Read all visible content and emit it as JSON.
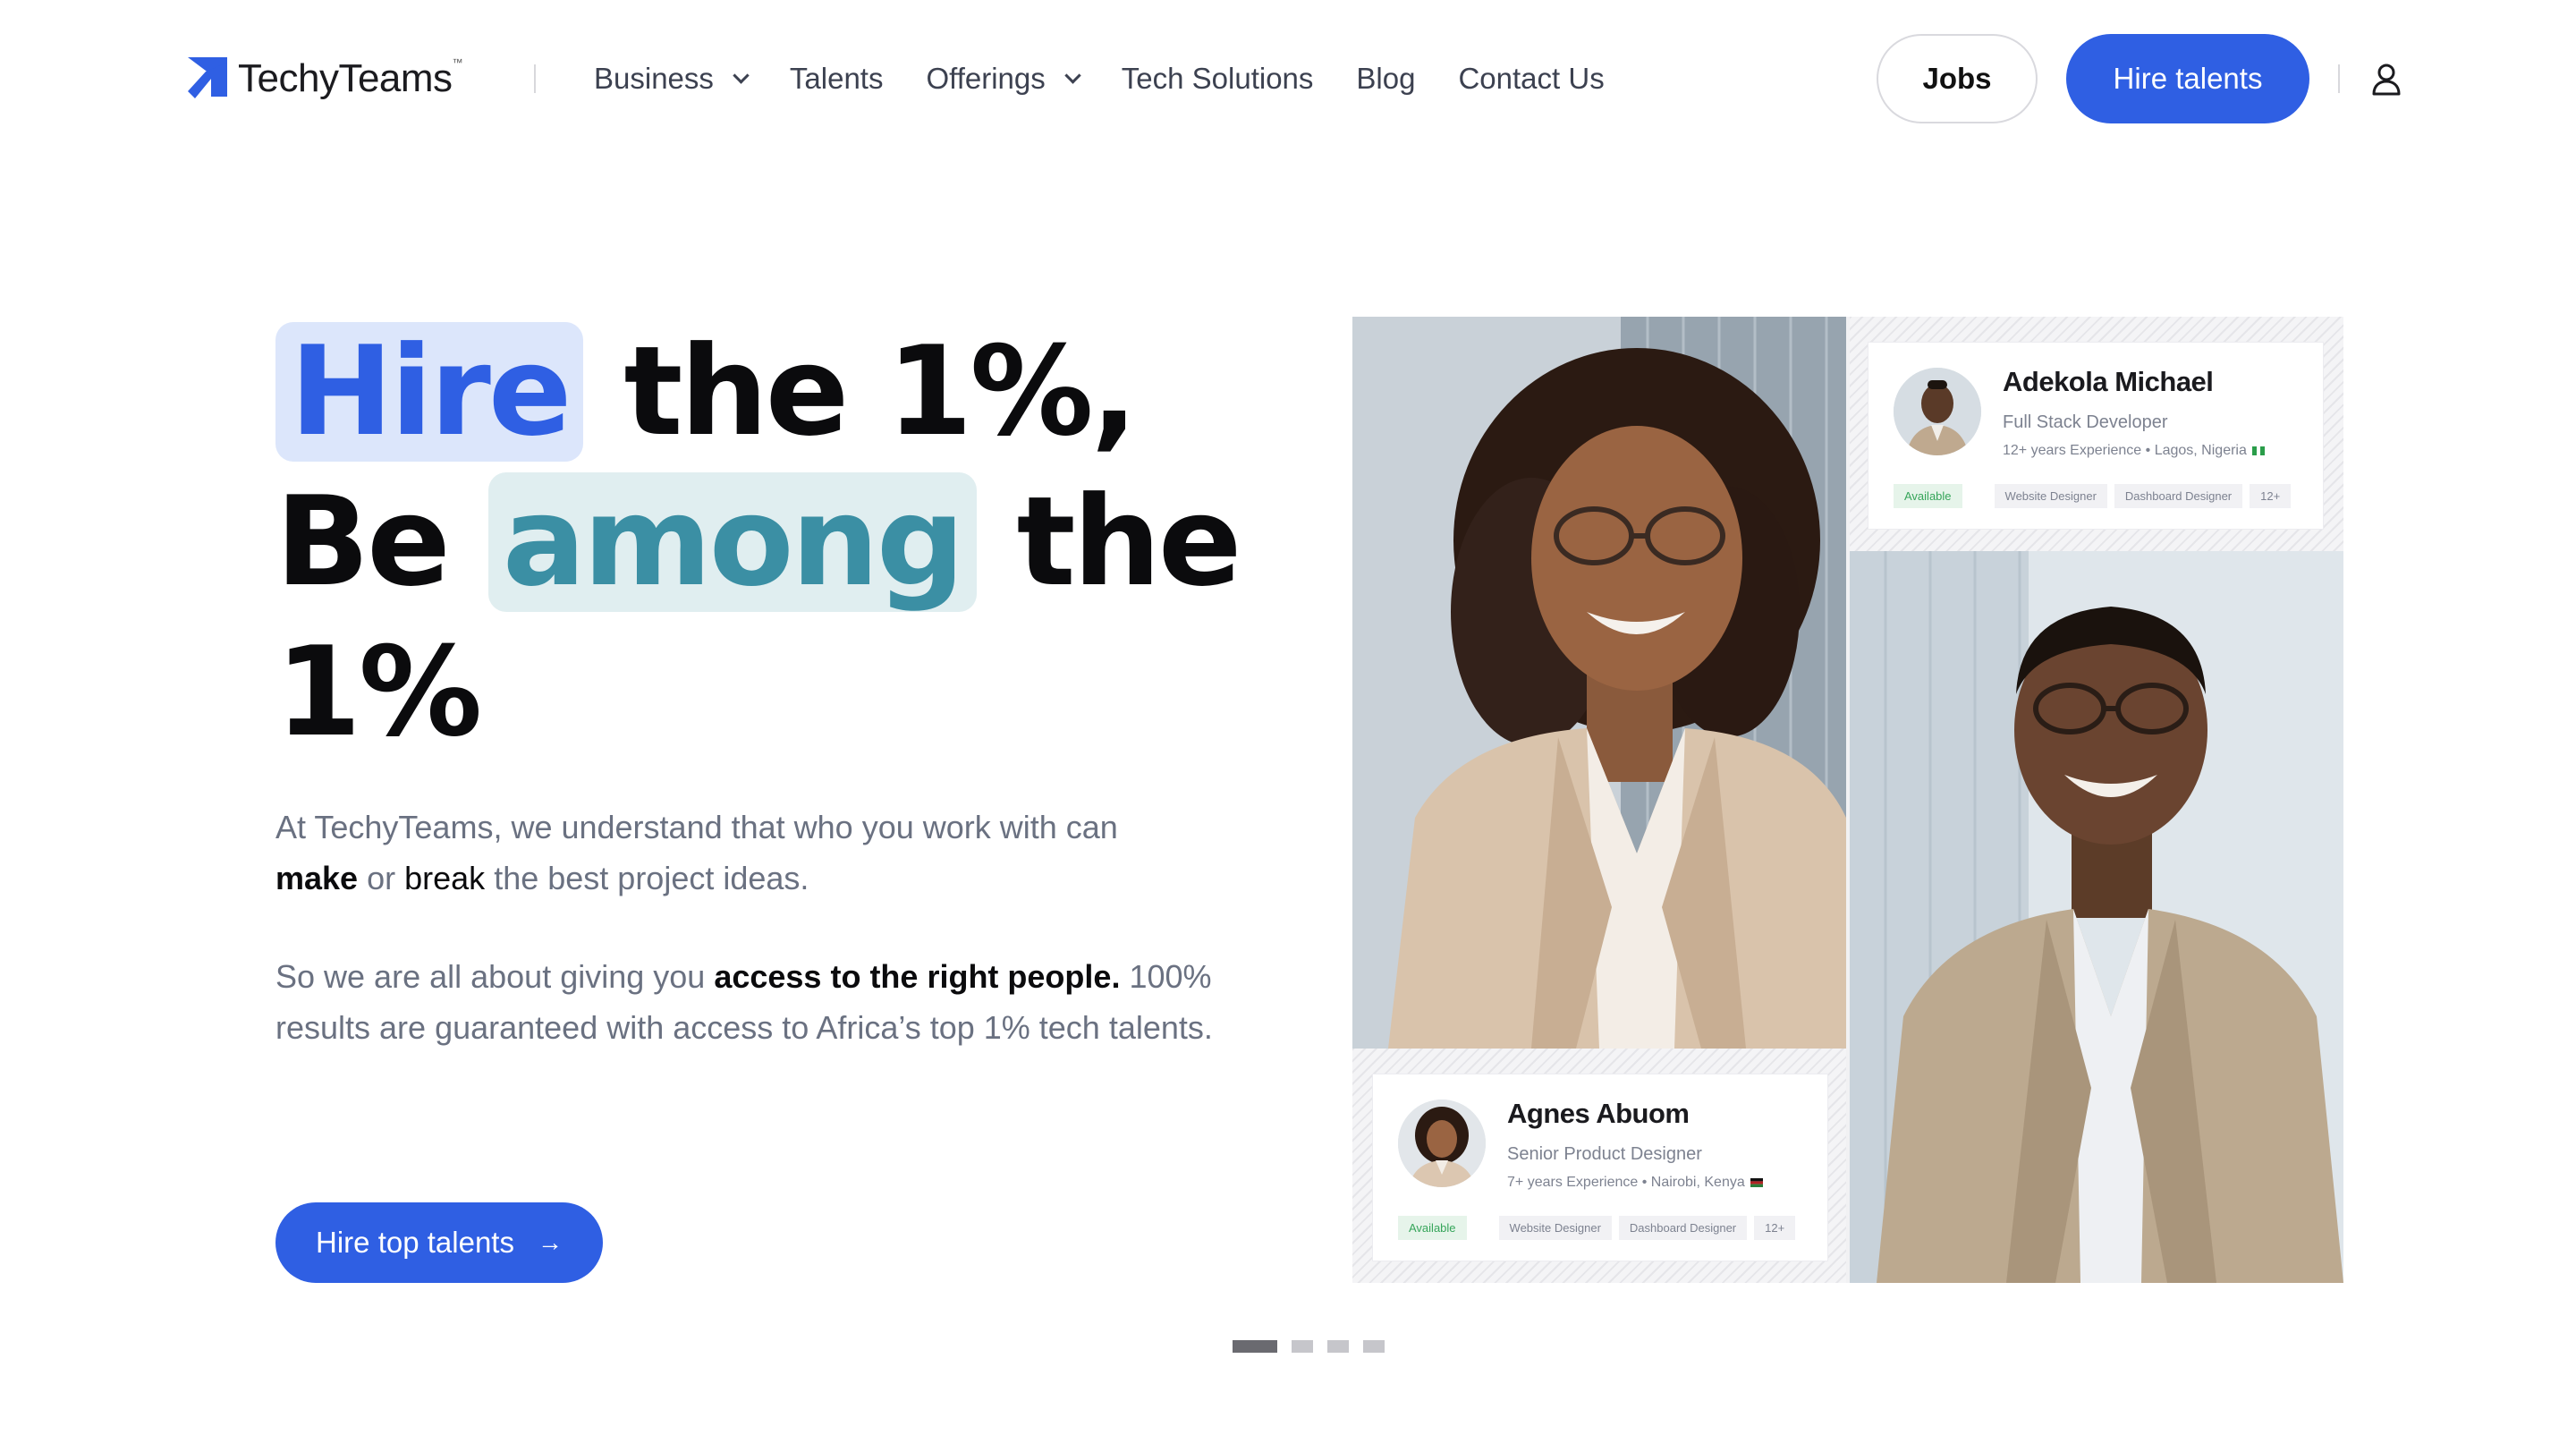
{
  "brand": {
    "name": "TechyTeams",
    "tm": "™",
    "accent": "#2f5fe3"
  },
  "nav": {
    "items": [
      {
        "label": "Business",
        "dropdown": true
      },
      {
        "label": "Talents",
        "dropdown": false
      },
      {
        "label": "Offerings",
        "dropdown": true
      },
      {
        "label": "Tech Solutions",
        "dropdown": false
      },
      {
        "label": "Blog",
        "dropdown": false
      },
      {
        "label": "Contact Us",
        "dropdown": false
      }
    ],
    "jobs_label": "Jobs",
    "hire_label": "Hire talents",
    "user_icon": "user-icon"
  },
  "hero": {
    "headline": {
      "w_hire": "Hire",
      "w_the1": "the 1%,",
      "w_be": "Be",
      "w_among": "among",
      "w_the2": "the",
      "w_pct": "1%"
    },
    "p1": {
      "a": "At TechyTeams, we understand that who you work with can",
      "make": "make",
      "or": "or",
      "break": "break",
      "b": "the best project ideas."
    },
    "p2": {
      "a": "So we are all about giving you",
      "bold": "access to the right people.",
      "b": "100% results are guaranteed with access to Africa’s top 1% tech talents."
    },
    "cta_label": "Hire top talents",
    "cta_arrow": "→"
  },
  "cards": {
    "top": {
      "name": "Adekola Michael",
      "role": "Full Stack Developer",
      "meta": "12+ years Experience • Lagos, Nigeria",
      "status": "Available",
      "tags": [
        "Website Designer",
        "Dashboard Designer",
        "12+"
      ]
    },
    "bottom": {
      "name": "Agnes Abuom",
      "role": "Senior Product Designer",
      "meta": "7+ years Experience • Nairobi, Kenya",
      "status": "Available",
      "tags": [
        "Website Designer",
        "Dashboard Designer",
        "12+"
      ]
    }
  },
  "carousel": {
    "slides": 4,
    "active": 1
  }
}
